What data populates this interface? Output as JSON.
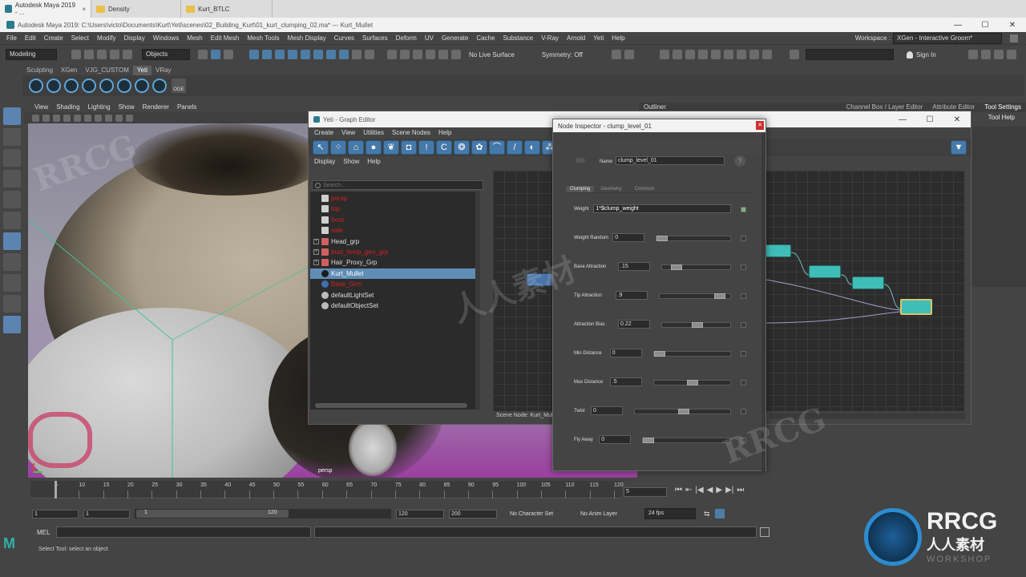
{
  "browser_tabs": [
    {
      "label": "Autodesk Maya 2019 - ...",
      "close": "×"
    },
    {
      "label": "Density"
    },
    {
      "label": "Kurt_BTLC"
    }
  ],
  "window": {
    "title": "Autodesk Maya 2019: C:\\Users\\victo\\Documents\\Kurt\\Yeti\\scenes\\02_Building_Kurt\\01_kurt_clumping_02.ma*  ---  Kurt_Mullet",
    "minimize": "—",
    "maximize": "☐",
    "close": "✕"
  },
  "menubar": {
    "items": [
      "File",
      "Edit",
      "Create",
      "Select",
      "Modify",
      "Display",
      "Windows",
      "Mesh",
      "Edit Mesh",
      "Mesh Tools",
      "Mesh Display",
      "Curves",
      "Surfaces",
      "Deform",
      "UV",
      "Generate",
      "Cache",
      "Substance",
      "V-Ray",
      "Arnold",
      "Yeti",
      "Help"
    ],
    "workspace_label": "Workspace :",
    "workspace_value": "XGen - Interactive Groom*"
  },
  "toolbar": {
    "mode": "Modeling",
    "selection_mode": "Objects",
    "live_surface": "No Live Surface",
    "symmetry": "Symmetry: Off",
    "sign_in": "Sign In"
  },
  "shelf": {
    "tabs": [
      "Sculpting",
      "XGen",
      "VJG_CUSTOM",
      "Yeti",
      "VRay"
    ],
    "active": "Yeti",
    "last_icon_label": "OGE"
  },
  "viewport": {
    "menus": [
      "View",
      "Shading",
      "Lighting",
      "Show",
      "Renderer",
      "Panels"
    ],
    "camera_label": "persp"
  },
  "right_panel": {
    "outliner_tab": "Outliner",
    "tabs": [
      "Channel Box / Layer Editor",
      "Attribute Editor",
      "Tool Settings"
    ],
    "tool_help": "Tool Help"
  },
  "graph_editor": {
    "title": "Yeti - Graph Editor",
    "menus": [
      "Create",
      "View",
      "Utilities",
      "Scene Nodes",
      "Help"
    ],
    "sub_menus": [
      "Display",
      "Show",
      "Help"
    ],
    "search_placeholder": "Search...",
    "outliner_items": [
      {
        "label": "persp",
        "red": true,
        "type": "camera"
      },
      {
        "label": "top",
        "red": true,
        "type": "camera"
      },
      {
        "label": "front",
        "red": true,
        "type": "camera"
      },
      {
        "label": "side",
        "red": true,
        "type": "camera"
      },
      {
        "label": "Head_grp",
        "red": false,
        "type": "group",
        "expandable": true
      },
      {
        "label": "bust_temp_geo_grp",
        "red": true,
        "type": "group",
        "expandable": true
      },
      {
        "label": "Hair_Proxy_Grp",
        "red": false,
        "type": "group",
        "expandable": true
      },
      {
        "label": "Kurt_Mullet",
        "red": false,
        "type": "yeti",
        "selected": true
      },
      {
        "label": "Base_Grm",
        "red": true,
        "type": "groom"
      },
      {
        "label": "defaultLightSet",
        "red": false,
        "type": "set"
      },
      {
        "label": "defaultObjectSet",
        "red": false,
        "type": "set"
      }
    ],
    "scene_node_label": "Scene Node: Kurt_Mullet"
  },
  "inspector": {
    "title": "Node Inspector - clump_level_01",
    "name_label": "Name",
    "name_value": "clump_level_01",
    "help": "?",
    "tabs": [
      "Clumping",
      "Geometry",
      "Common"
    ],
    "active_tab": "Clumping",
    "params": [
      {
        "label": "Weight",
        "value": "1*$clump_weight",
        "slider": null
      },
      {
        "label": "Weight Random",
        "value": "0",
        "slider": 0.0
      },
      {
        "label": "Base Attraction",
        "value": ".15",
        "slider": 0.15
      },
      {
        "label": "Tip Attraction",
        "value": ".9",
        "slider": 0.9
      },
      {
        "label": "Attraction Bias",
        "value": "0.22",
        "slider": 0.5
      },
      {
        "label": "Min Distance",
        "value": "0",
        "slider": 0.0
      },
      {
        "label": "Max Distance",
        "value": ".5",
        "slider": 0.5
      },
      {
        "label": "Twist",
        "value": "0",
        "slider": 0.5
      },
      {
        "label": "Fly Away",
        "value": "0",
        "slider": 0.0
      }
    ]
  },
  "timeline": {
    "ticks": [
      "5",
      "10",
      "15",
      "20",
      "25",
      "30",
      "35",
      "40",
      "45",
      "50",
      "55",
      "60",
      "65",
      "70",
      "75",
      "80",
      "85",
      "90",
      "95",
      "100",
      "105",
      "110",
      "115",
      "120"
    ],
    "current_frame": "5",
    "range_start": "1",
    "range_start2": "1",
    "slider_left": "1",
    "slider_right": "120",
    "range_end": "120",
    "range_end2": "200",
    "character_set": "No Character Set",
    "anim_layer": "No Anim Layer",
    "fps": "24 fps"
  },
  "mel": {
    "label": "MEL"
  },
  "help_line": "Select Tool: select an object",
  "watermark": {
    "brand": "RRCG",
    "sub": "人人素材",
    "ws": "WORKSHOP"
  },
  "colors": {
    "accent_blue": "#5f8db5",
    "node_teal": "#3fbdb7",
    "viewport_purple": "#9b3fa0",
    "red_item": "#d32020"
  }
}
